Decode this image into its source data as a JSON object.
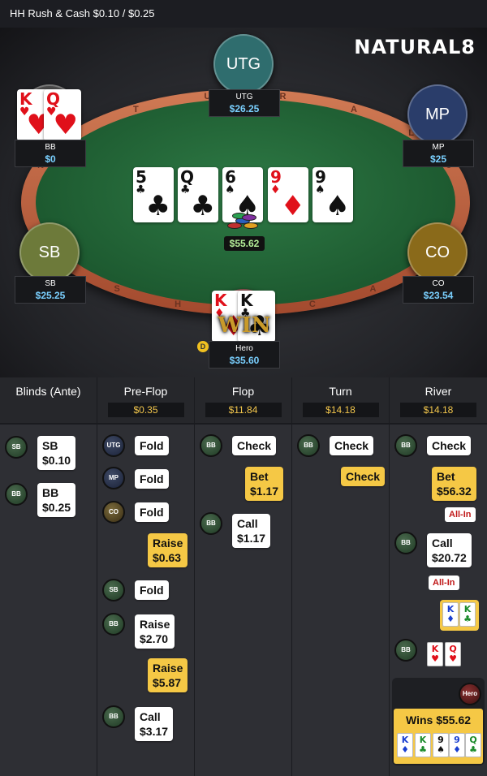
{
  "topbar": {
    "title": "HH  Rush & Cash $0.10 / $0.25"
  },
  "logo": {
    "text_a": "NATURAL",
    "text_b": "8"
  },
  "rail_letters": [
    "N",
    "A",
    "T",
    "U",
    "R",
    "A",
    "L",
    "8",
    "R",
    "U",
    "S",
    "H",
    "&",
    "C",
    "A",
    "S",
    "H"
  ],
  "seats": {
    "utg": {
      "label": "UTG",
      "name": "UTG",
      "stack": "$26.25",
      "color": "#2f6d6e"
    },
    "mp": {
      "label": "MP",
      "name": "MP",
      "stack": "$25",
      "color": "#2a3d6a"
    },
    "co": {
      "label": "CO",
      "name": "CO",
      "stack": "$23.54",
      "color": "#8a6a1a"
    },
    "sb": {
      "label": "SB",
      "name": "SB",
      "stack": "$25.25",
      "color": "#6d7a3a"
    },
    "bb": {
      "name": "BB",
      "stack": "$0"
    },
    "hero": {
      "name": "Hero",
      "stack": "$35.60"
    }
  },
  "bb_cards": [
    {
      "rank": "K",
      "suit": "♥",
      "color": "red"
    },
    {
      "rank": "Q",
      "suit": "♥",
      "color": "red"
    }
  ],
  "hero_cards": [
    {
      "rank": "K",
      "suit": "♦",
      "color": "red"
    },
    {
      "rank": "K",
      "suit": "♣",
      "color": "blk"
    }
  ],
  "win_overlay": "WIN",
  "board": [
    {
      "rank": "5",
      "suit": "♣",
      "color": "blk"
    },
    {
      "rank": "Q",
      "suit": "♣",
      "color": "blk"
    },
    {
      "rank": "6",
      "suit": "♠",
      "color": "blk"
    },
    {
      "rank": "9",
      "suit": "♦",
      "color": "red"
    },
    {
      "rank": "9",
      "suit": "♠",
      "color": "blk"
    }
  ],
  "pot": "$55.62",
  "dealer": "D",
  "streets": {
    "blinds": {
      "name": "Blinds (Ante)"
    },
    "preflop": {
      "name": "Pre-Flop",
      "amount": "$0.35"
    },
    "flop": {
      "name": "Flop",
      "amount": "$11.84"
    },
    "turn": {
      "name": "Turn",
      "amount": "$14.18"
    },
    "river": {
      "name": "River",
      "amount": "$14.18"
    }
  },
  "actions": {
    "blinds": [
      {
        "who": "SB",
        "line1": "SB",
        "line2": "$0.10"
      },
      {
        "who": "BB",
        "line1": "BB",
        "line2": "$0.25"
      }
    ],
    "preflop": [
      {
        "who": "UTG",
        "line1": "Fold"
      },
      {
        "who": "MP",
        "line1": "Fold"
      },
      {
        "who": "CO",
        "line1": "Fold"
      },
      {
        "who": "Hero",
        "line1": "Raise",
        "line2": "$0.63"
      },
      {
        "who": "SB",
        "line1": "Fold"
      },
      {
        "who": "BB",
        "line1": "Raise",
        "line2": "$2.70"
      },
      {
        "who": "Hero",
        "line1": "Raise",
        "line2": "$5.87"
      },
      {
        "who": "BB",
        "line1": "Call",
        "line2": "$3.17"
      }
    ],
    "flop": [
      {
        "who": "BB",
        "line1": "Check"
      },
      {
        "who": "Hero",
        "line1": "Bet",
        "line2": "$1.17"
      },
      {
        "who": "BB",
        "line1": "Call",
        "line2": "$1.17"
      }
    ],
    "turn": [
      {
        "who": "BB",
        "line1": "Check"
      },
      {
        "who": "Hero",
        "line1": "Check"
      }
    ],
    "river": [
      {
        "who": "BB",
        "line1": "Check"
      },
      {
        "who": "Hero",
        "line1": "Bet",
        "line2": "$56.32",
        "tag": "All-In"
      },
      {
        "who": "BB",
        "line1": "Call",
        "line2": "$20.72",
        "tag": "All-In"
      }
    ]
  },
  "showdown": {
    "hero": [
      {
        "rank": "K",
        "suit": "♦",
        "color": "blu"
      },
      {
        "rank": "K",
        "suit": "♣",
        "color": "grn"
      }
    ],
    "bb": [
      {
        "rank": "K",
        "suit": "♥",
        "color": "red"
      },
      {
        "rank": "Q",
        "suit": "♥",
        "color": "red"
      }
    ],
    "winner": "Hero",
    "wins": "Wins $55.62",
    "best_hand": [
      {
        "rank": "K",
        "suit": "♦",
        "color": "blu"
      },
      {
        "rank": "K",
        "suit": "♣",
        "color": "grn"
      },
      {
        "rank": "9",
        "suit": "♠",
        "color": "blk"
      },
      {
        "rank": "9",
        "suit": "♦",
        "color": "blu"
      },
      {
        "rank": "Q",
        "suit": "♣",
        "color": "grn"
      }
    ]
  },
  "avatar_labels": {
    "UTG": "UTG",
    "MP": "MP",
    "CO": "CO",
    "SB": "SB",
    "BB": "BB",
    "Hero": "Hero"
  }
}
